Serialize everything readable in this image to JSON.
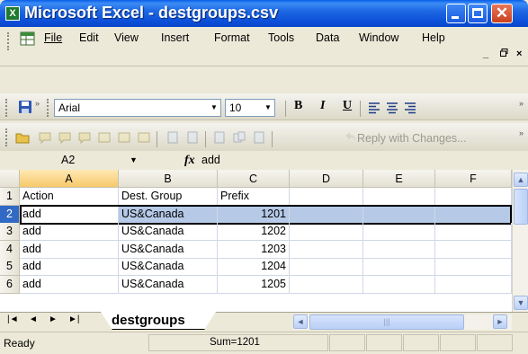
{
  "window": {
    "title": "Microsoft Excel - destgroups.csv",
    "app_icon": "excel-icon",
    "colors": {
      "titlebar": "#0a4fd8",
      "close_button": "#d7522c"
    }
  },
  "menubar": {
    "items": [
      "File",
      "Edit",
      "View",
      "Insert",
      "Format",
      "Tools",
      "Data",
      "Window",
      "Help"
    ],
    "doc_controls": [
      "_",
      "    ",
      "×"
    ]
  },
  "formatting_toolbar": {
    "font_name": "Arial",
    "font_size": "10",
    "bold_label": "B",
    "italic_label": "I",
    "underline_label": "U"
  },
  "reviewing_toolbar": {
    "reply_label": "Reply with Changes..."
  },
  "formula_bar": {
    "cell_ref": "A2",
    "fx_label": "fx",
    "value": "add"
  },
  "sheet": {
    "columns": [
      "A",
      "B",
      "C",
      "D",
      "E",
      "F"
    ],
    "rows": [
      {
        "num": "1",
        "cells": [
          "Action",
          "Dest. Group",
          "Prefix",
          "",
          "",
          ""
        ]
      },
      {
        "num": "2",
        "cells": [
          "add",
          "US&Canada",
          "1201",
          "",
          "",
          ""
        ]
      },
      {
        "num": "3",
        "cells": [
          "add",
          "US&Canada",
          "1202",
          "",
          "",
          ""
        ]
      },
      {
        "num": "4",
        "cells": [
          "add",
          "US&Canada",
          "1203",
          "",
          "",
          ""
        ]
      },
      {
        "num": "5",
        "cells": [
          "add",
          "US&Canada",
          "1204",
          "",
          "",
          ""
        ]
      },
      {
        "num": "6",
        "cells": [
          "add",
          "US&Canada",
          "1205",
          "",
          "",
          ""
        ]
      }
    ],
    "selected_row": "2",
    "active_cell": "A2"
  },
  "tabs": {
    "sheet_name": "destgroups"
  },
  "statusbar": {
    "ready": "Ready",
    "sum": "Sum=1201"
  }
}
